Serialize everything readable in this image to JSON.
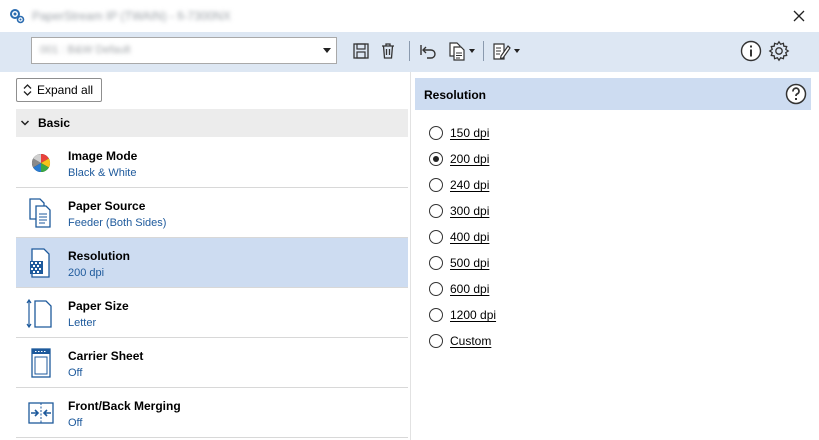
{
  "window": {
    "title": "PaperStream IP (TWAIN) - fi-7300NX",
    "close_icon": "close-icon"
  },
  "toolbar": {
    "profile_value": "001 : B&W Default",
    "buttons": [
      "save-icon",
      "delete-icon",
      "undo-icon",
      "copy-icon",
      "edit-icon",
      "info-icon",
      "settings-icon"
    ]
  },
  "left": {
    "expand_all_label": "Expand all",
    "group_label": "Basic",
    "settings": [
      {
        "title": "Image Mode",
        "value": "Black & White",
        "icon": "image-mode-icon"
      },
      {
        "title": "Paper Source",
        "value": "Feeder (Both Sides)",
        "icon": "paper-source-icon"
      },
      {
        "title": "Resolution",
        "value": "200 dpi",
        "icon": "resolution-icon",
        "selected": true
      },
      {
        "title": "Paper Size",
        "value": "Letter",
        "icon": "paper-size-icon"
      },
      {
        "title": "Carrier Sheet",
        "value": "Off",
        "icon": "carrier-sheet-icon"
      },
      {
        "title": "Front/Back Merging",
        "value": "Off",
        "icon": "merging-icon"
      }
    ]
  },
  "right": {
    "panel_title": "Resolution",
    "help_icon": "help-icon",
    "options": [
      {
        "label": "150 dpi",
        "checked": false
      },
      {
        "label": "200 dpi",
        "checked": true
      },
      {
        "label": "240 dpi",
        "checked": false
      },
      {
        "label": "300 dpi",
        "checked": false
      },
      {
        "label": "400 dpi",
        "checked": false
      },
      {
        "label": "500 dpi",
        "checked": false
      },
      {
        "label": "600 dpi",
        "checked": false
      },
      {
        "label": "1200 dpi",
        "checked": false
      },
      {
        "label": "Custom",
        "checked": false
      }
    ]
  },
  "colors": {
    "toolbar_bg": "#dde7f3",
    "selected_bg": "#cddcf1",
    "value_text": "#1e5a9c",
    "group_bg": "#ececec"
  }
}
